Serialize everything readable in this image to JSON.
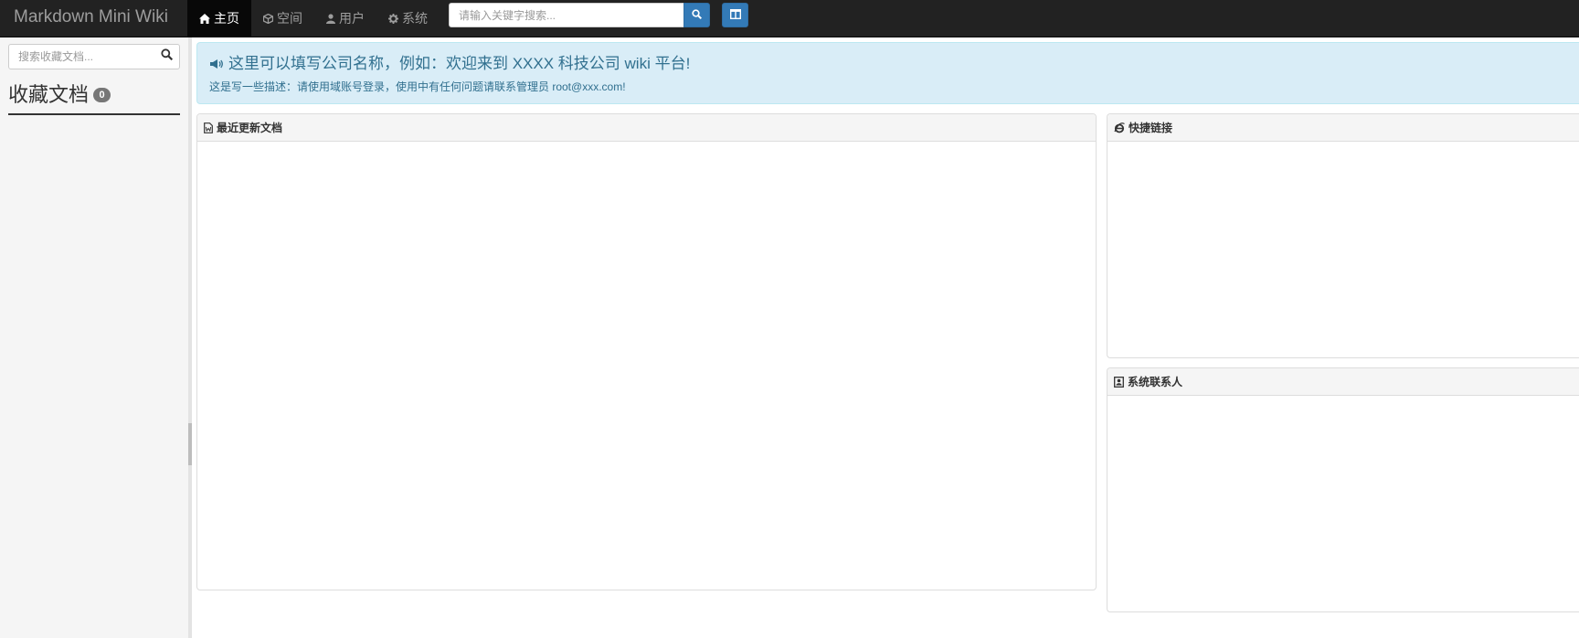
{
  "header": {
    "brand": "Markdown Mini Wiki",
    "nav": [
      {
        "label": "主页",
        "icon": "home-icon",
        "active": true
      },
      {
        "label": "空间",
        "icon": "cube-icon",
        "active": false
      },
      {
        "label": "用户",
        "icon": "user-icon",
        "active": false
      },
      {
        "label": "系统",
        "icon": "gear-icon",
        "active": false
      }
    ],
    "search_placeholder": "请输入关键字搜索...",
    "search_icon": "search-icon",
    "toggle_icon": "columns-icon"
  },
  "sidebar": {
    "search_placeholder": "搜索收藏文档...",
    "fav_title": "收藏文档",
    "fav_count": "0"
  },
  "alert": {
    "icon": "bullhorn-icon",
    "title": "这里可以填写公司名称，例如：欢迎来到 XXXX 科技公司 wiki 平台!",
    "description": "这是写一些描述：请使用域账号登录，使用中有任何问题请联系管理员 root@xxx.com!"
  },
  "panels": {
    "recent": {
      "title": "最近更新文档",
      "icon": "word-file-icon"
    },
    "links": {
      "title": "快捷链接",
      "icon": "ie-browser-icon"
    },
    "contacts": {
      "title": "系统联系人",
      "icon": "contact-book-icon"
    }
  },
  "colors": {
    "navbar": "#222222",
    "primary": "#337ab7",
    "alert_bg": "#d9edf7",
    "alert_text": "#31708f"
  }
}
